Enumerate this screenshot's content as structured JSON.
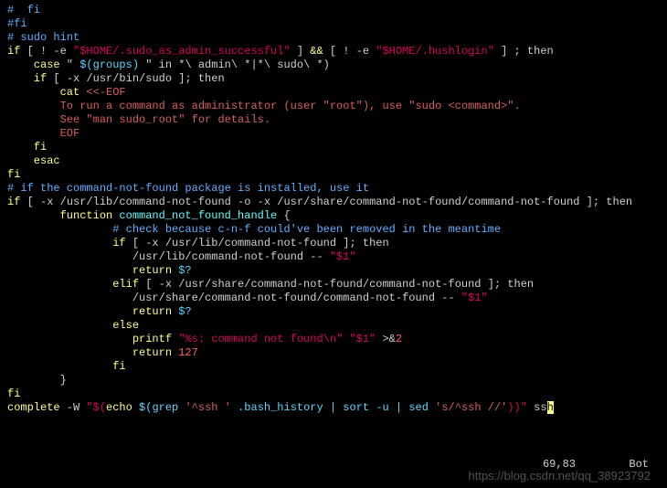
{
  "lines": {
    "l1": "#  fi",
    "l2": "#fi",
    "l3": "",
    "l4": "# sudo hint",
    "l5a": "if",
    "l5b": " [ ! -e ",
    "l5c": "\"$HOME/.sudo_as_admin_successful\"",
    "l5d": " ] ",
    "l5e": "&&",
    "l5f": " [ ! -e ",
    "l5g": "\"$HOME/.hushlogin\"",
    "l5h": " ] ; then",
    "l6a": "    case",
    "l6b": " \" ",
    "l6c": "$(groups)",
    "l6d": " \" in *\\ admin\\ *|*\\ sudo\\ *)",
    "l7a": "    if",
    "l7b": " [ -x /usr/bin/sudo ]; then",
    "l8a": "        cat",
    "l8b": " <<-EOF",
    "l9": "        To run a command as administrator (user \"root\"), use \"sudo <command>\".",
    "l10": "        See \"man sudo_root\" for details.",
    "l11": "",
    "l12": "        EOF",
    "l13": "    fi",
    "l14": "    esac",
    "l15": "fi",
    "l16": "",
    "l17": "# if the command-not-found package is installed, use it",
    "l18a": "if",
    "l18b": " [ -x /usr/lib/command-not-found -o -x /usr/share/command-not-found/command-not-found ]; then",
    "l19a": "        function",
    "l19b": " ",
    "l19c": "command_not_found_handle",
    "l19d": " {",
    "l20": "                # check because c-n-f could've been removed in the meantime",
    "l21a": "                if",
    "l21b": " [ -x /usr/lib/command-not-found ]; then",
    "l22a": "                   /usr/lib/command-not-found -- ",
    "l22b": "\"$1\"",
    "l23a": "                   return",
    "l23b": " ",
    "l23c": "$?",
    "l24a": "                elif",
    "l24b": " [ -x /usr/share/command-not-found/command-not-found ]; then",
    "l25a": "                   /usr/share/command-not-found/command-not-found -- ",
    "l25b": "\"$1\"",
    "l26a": "                   return",
    "l26b": " ",
    "l26c": "$?",
    "l27": "                else",
    "l28a": "                   printf",
    "l28b": " ",
    "l28c": "\"%s: command not found\\n\"",
    "l28d": " ",
    "l28e": "\"$1\"",
    "l28f": " >&",
    "l28g": "2",
    "l29a": "                   return",
    "l29b": " ",
    "l29c": "127",
    "l30": "                fi",
    "l31": "        }",
    "l32": "fi",
    "l33a": "complete",
    "l33b": " -W ",
    "l33c": "\"$(",
    "l33d": "echo",
    "l33e": " ",
    "l33f": "$(grep ",
    "l33g": "'^ssh '",
    "l33h": " .bash_history | sort -u | sed ",
    "l33i": "'s/^ssh //'",
    "l33j": "))\"",
    "l33k": " ss",
    "l33cur": "h"
  },
  "status": {
    "pos": "69,83",
    "loc": "Bot"
  },
  "watermark": "https://blog.csdn.net/qq_38923792"
}
